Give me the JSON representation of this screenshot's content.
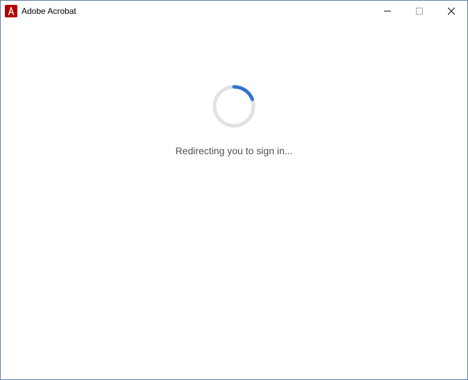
{
  "titlebar": {
    "title": "Adobe Acrobat"
  },
  "content": {
    "status_text": "Redirecting you to sign in..."
  },
  "colors": {
    "spinner_track": "#e2e2e2",
    "spinner_arc": "#2e73d1",
    "app_icon_bg": "#b30000"
  }
}
